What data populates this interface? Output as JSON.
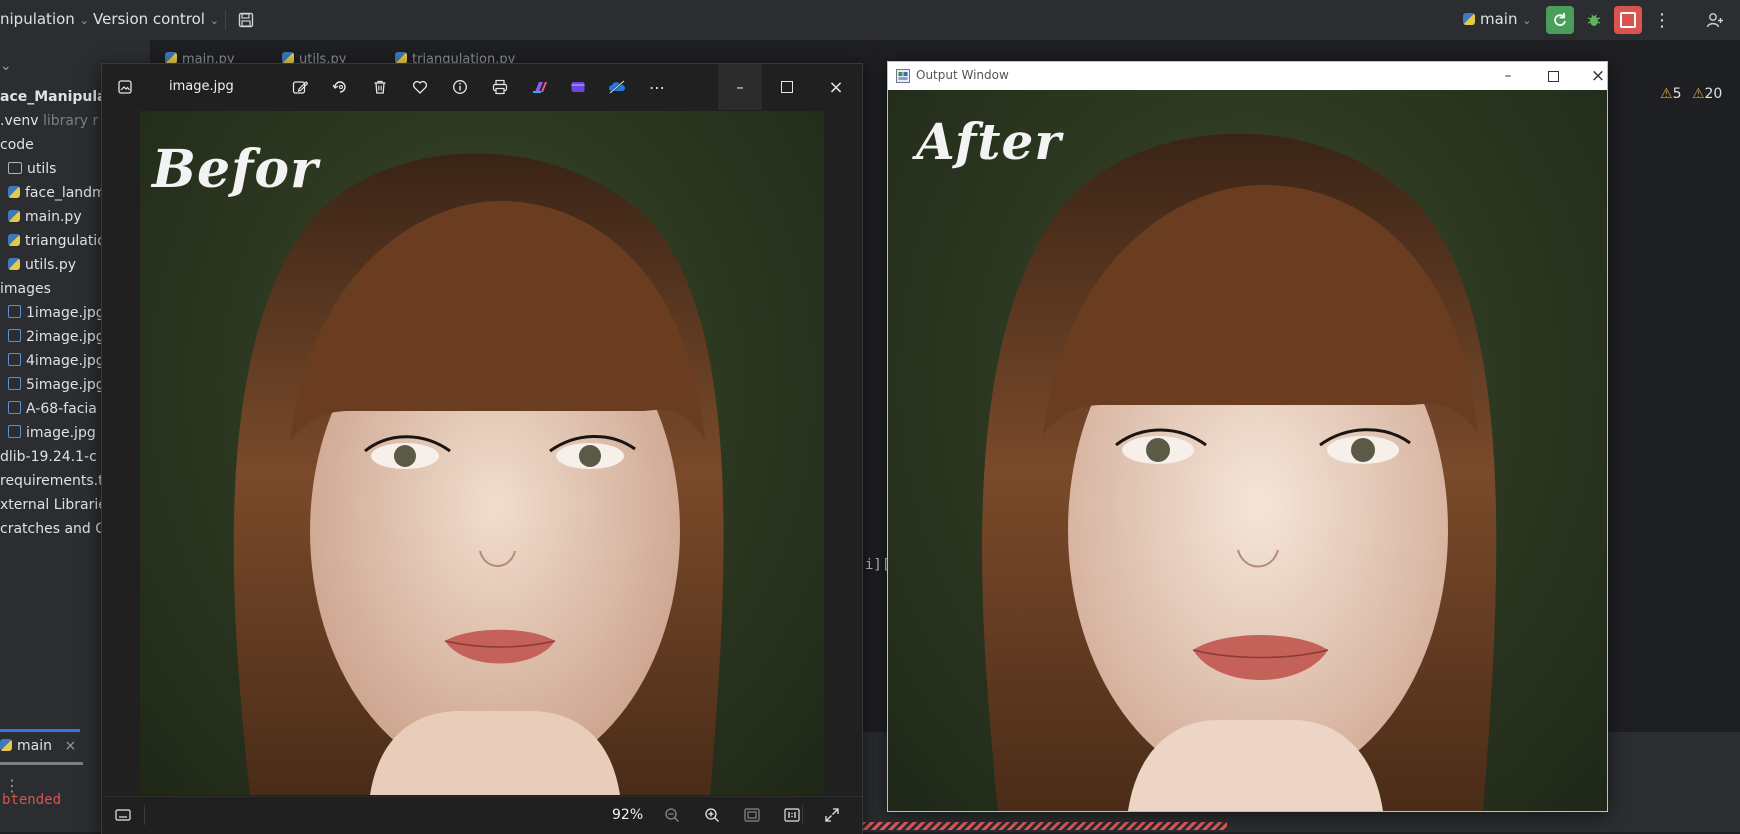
{
  "ide": {
    "project_menu": "nipulation",
    "vcs_menu": "Version control",
    "branch": "main",
    "warnings": "5",
    "weak_warnings": "20",
    "run_tab": "main",
    "editor_fragment": "i][",
    "console_fragment": "btended",
    "tabs": [
      "main.py",
      "utils.py",
      "triangulation.py"
    ]
  },
  "sidebar": {
    "items": [
      {
        "label": "ace_Manipulatio",
        "kind": "root"
      },
      {
        "label": ".venv",
        "suffix": "library r",
        "kind": "folder"
      },
      {
        "label": "code",
        "kind": "folder"
      },
      {
        "label": "utils",
        "kind": "folder"
      },
      {
        "label": "face_landm",
        "kind": "py"
      },
      {
        "label": "main.py",
        "kind": "py"
      },
      {
        "label": "triangulatio",
        "kind": "py"
      },
      {
        "label": "utils.py",
        "kind": "py"
      },
      {
        "label": "images",
        "kind": "folder"
      },
      {
        "label": "1image.jpg",
        "kind": "img"
      },
      {
        "label": "2image.jpg",
        "kind": "img"
      },
      {
        "label": "4image.jpg",
        "kind": "img"
      },
      {
        "label": "5image.jpg",
        "kind": "img"
      },
      {
        "label": "A-68-facia",
        "kind": "img"
      },
      {
        "label": "image.jpg",
        "kind": "img"
      },
      {
        "label": "dlib-19.24.1-c",
        "kind": "file"
      },
      {
        "label": "requirements.t",
        "kind": "file"
      },
      {
        "label": "xternal Libraries",
        "kind": "lib"
      },
      {
        "label": "cratches and Co",
        "kind": "lib"
      }
    ]
  },
  "photos_viewer": {
    "filename": "image.jpg",
    "zoom": "92%",
    "image_caption": "Befor"
  },
  "output_window": {
    "title": "Output Window",
    "image_caption": "After"
  },
  "colors": {
    "ide_bg": "#2b2d30",
    "run_green": "#4b9e5a",
    "stop_red": "#d9534f",
    "photos_bg": "#202020",
    "backdrop_green": "#2b3620",
    "hair_brown": "#5a341c"
  }
}
